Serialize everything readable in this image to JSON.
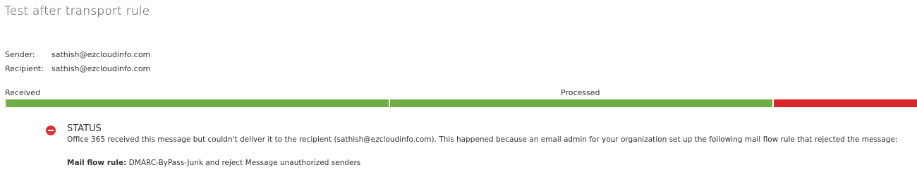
{
  "page": {
    "title": "Test after transport rule"
  },
  "message": {
    "sender_label": "Sender:",
    "sender_value": "sathish@ezcloudinfo.com",
    "recipient_label": "Recipient:",
    "recipient_value": "sathish@ezcloudinfo.com"
  },
  "progress": {
    "stages": [
      {
        "label": "Received"
      },
      {
        "label": "Processed"
      }
    ],
    "segments": [
      {
        "state": "success",
        "color": "#70ad47"
      },
      {
        "state": "success",
        "color": "#70ad47"
      },
      {
        "state": "failed",
        "color": "#d9252b"
      }
    ]
  },
  "status": {
    "icon": "error-block-icon",
    "title": "STATUS",
    "message": "Office 365 received this message but couldn't deliver it to the recipient (sathish@ezcloudinfo.com). This happened because an email admin for your organization set up the following mail flow rule that rejected the message:",
    "rule_label": "Mail flow rule:",
    "rule_value": "DMARC-ByPass-Junk and reject Message unauthorized senders"
  }
}
